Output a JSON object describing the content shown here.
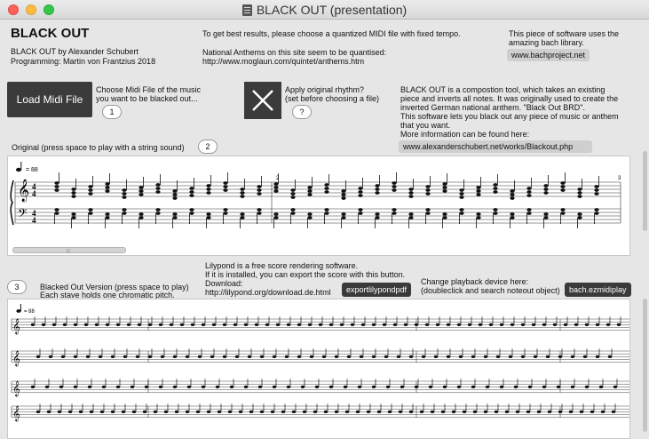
{
  "window": {
    "title": "BLACK OUT (presentation)"
  },
  "header": {
    "title": "BLACK OUT",
    "credit_line1": "BLACK OUT by Alexander Schubert",
    "credit_line2": "Programming: Martin von Frantzius 2018"
  },
  "hints": {
    "best_results": "To get best results, please choose a quantized MIDI file with fixed tempo.",
    "anthems_line1": "National Anthems on this site seem to be quantised:",
    "anthems_line2": "http://www.moglaun.com/quintet/anthems.htm",
    "bach_line1": "This piece of software uses the",
    "bach_line2": "amazing bach library.",
    "bach_link": "www.bachproject.net"
  },
  "load": {
    "button_label": "Load Midi File",
    "desc_line1": "Choose Midi File of the music",
    "desc_line2": "you want to be blacked out...",
    "bubble": "1"
  },
  "rhythm": {
    "desc_line1": "Apply original rhythm?",
    "desc_line2": "(set before choosing a file)",
    "bubble": "?"
  },
  "about": {
    "line1": "BLACK OUT is a compostion tool, which takes an existing",
    "line2": "piece and inverts all notes. It was originally used to create the",
    "line3": "inverted German national anthem. \"Black Out BRD\".",
    "line4": "This software lets you black out any piece of music or anthem",
    "line5": "that you want.",
    "line6": "More information can be found here:",
    "link": "www.alexanderschubert.net/works/Blackout.php"
  },
  "original": {
    "label": "Original (press space to play with a string sound)",
    "bubble": "2",
    "tempo": "= 88"
  },
  "blacked": {
    "bubble": "3",
    "label_line1": "Blacked Out Version (press space to play)",
    "label_line2": "Each stave holds one chromatic pitch.",
    "tempo": "= 88"
  },
  "lilypond": {
    "line1": "Lilypond is a free score rendering software.",
    "line2": "If it is installed, you can export the score with this button.",
    "line3": "Download:",
    "line4": "http://lilypond.org/download.de.html",
    "button": "exportlilypondpdf"
  },
  "playback": {
    "line1": "Change playback device here:",
    "line2": "(doubleclick and search noteout object)",
    "button": "bach.ezmidiplay"
  },
  "icons": [
    "document-icon",
    "close-x-icon",
    "treble-clef-icon",
    "bass-clef-icon",
    "quarter-note-icon"
  ]
}
